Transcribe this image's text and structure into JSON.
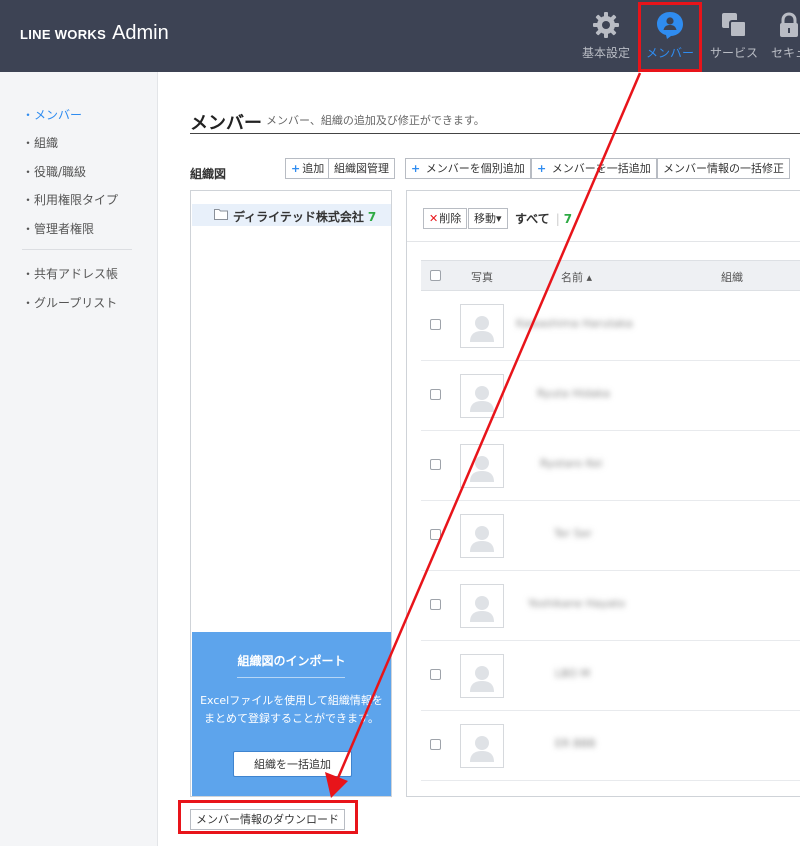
{
  "header": {
    "brand_main": "LINE WORKS",
    "brand_sub": "Admin",
    "nav": [
      {
        "label": "基本設定",
        "icon": "gear-icon"
      },
      {
        "label": "メンバー",
        "icon": "member-icon"
      },
      {
        "label": "サービス",
        "icon": "service-icon"
      },
      {
        "label": "セキュ",
        "icon": "lock-icon"
      }
    ],
    "accent_color": "#2f8cf0",
    "highlight_color": "#e8141a"
  },
  "sidebar": {
    "items": [
      {
        "label": "・メンバー"
      },
      {
        "label": "・組織"
      },
      {
        "label": "・役職/職級"
      },
      {
        "label": "・利用権限タイプ"
      },
      {
        "label": "・管理者権限"
      },
      {
        "label": "・共有アドレス帳"
      },
      {
        "label": "・グループリスト"
      }
    ]
  },
  "main": {
    "title": "メンバー",
    "description": "メンバー、組織の追加及び修正ができます。",
    "org_label": "組織図",
    "org_buttons": {
      "add": "追加",
      "manage": "組織図管理"
    },
    "member_buttons": {
      "add_single": "メンバーを個別追加",
      "add_bulk": "メンバーを一括追加",
      "edit_bulk": "メンバー情報の一括修正"
    },
    "tree": {
      "company": "ディライテッド株式会社",
      "count": "7"
    },
    "import": {
      "title": "組織図のインポート",
      "description": "Excelファイルを使用して組織情報をまとめて登録することができます。",
      "button": "組織を一括追加"
    },
    "list": {
      "delete": "削除",
      "move": "移動▾",
      "all_label": "すべて",
      "all_count": "7",
      "columns": {
        "photo": "写真",
        "name": "名前 ▴",
        "org": "組織"
      },
      "rows": [
        {
          "name": "Kawashima Harutaka"
        },
        {
          "name": "Ryuta Hidaka"
        },
        {
          "name": "Ryotaro Kei"
        },
        {
          "name": "Ter Ser"
        },
        {
          "name": "Yoshikane Hayato"
        },
        {
          "name": "LBO M"
        },
        {
          "name": "ER BBB"
        }
      ]
    },
    "download_button": "メンバー情報のダウンロード"
  }
}
